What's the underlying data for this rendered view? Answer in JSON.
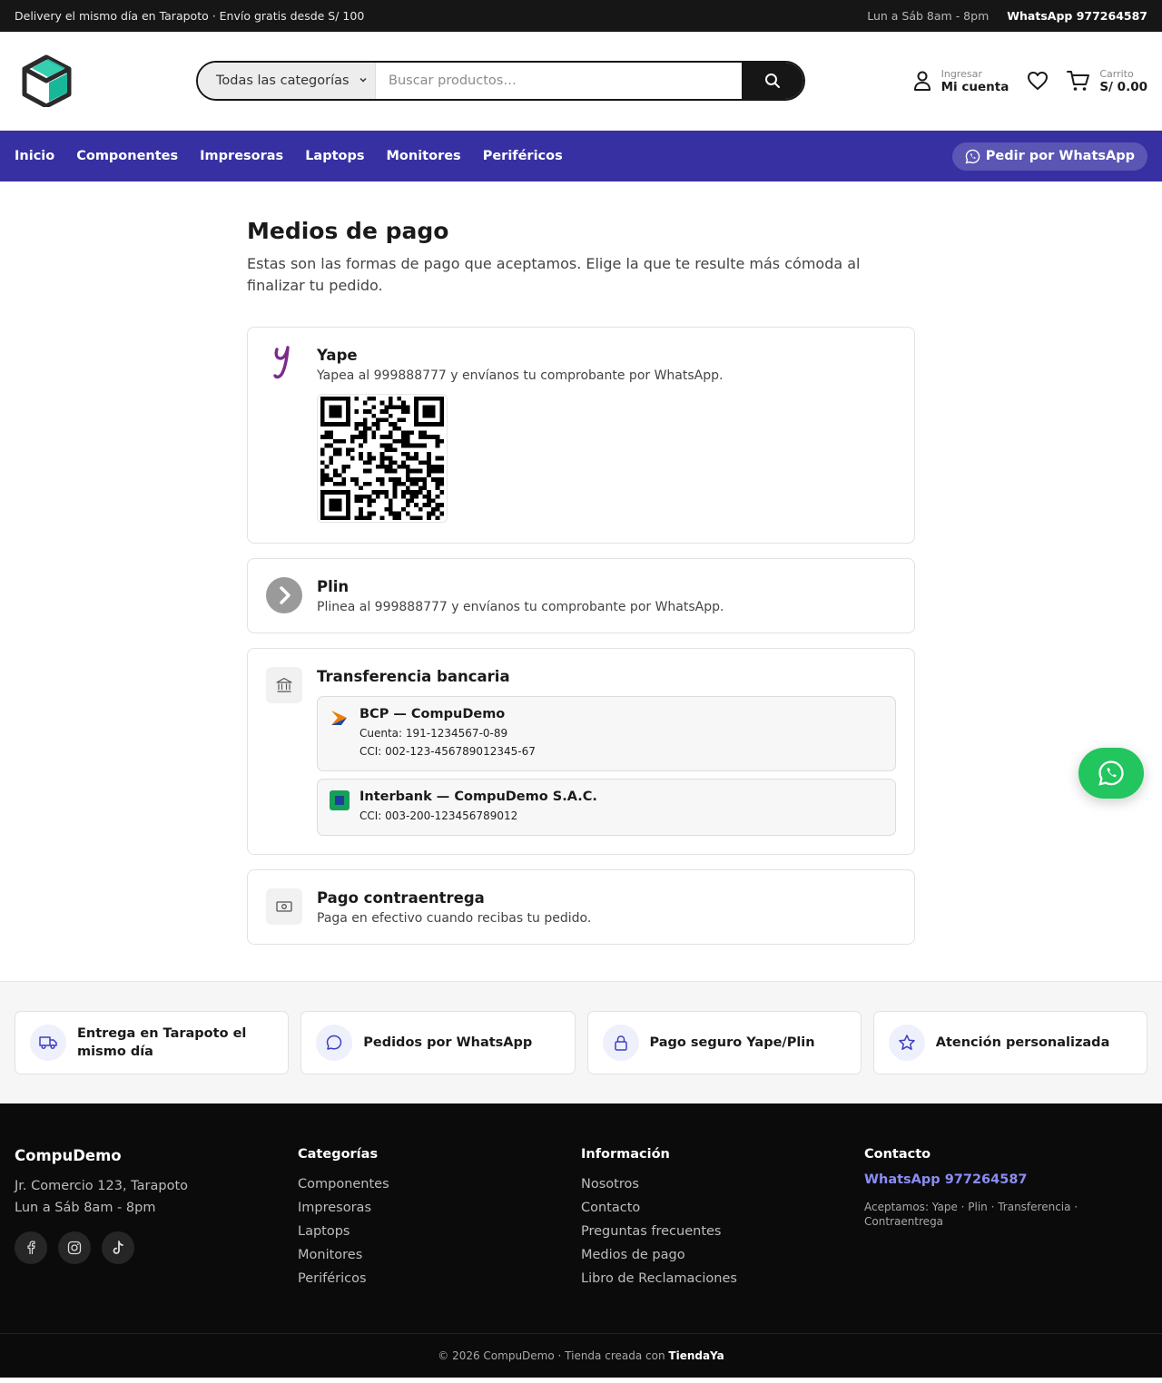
{
  "topbar": {
    "promo": "Delivery el mismo día en Tarapoto · Envío gratis desde S/ 100",
    "hours": "Lun a Sáb 8am - 8pm",
    "whatsapp": "WhatsApp 977264587"
  },
  "header": {
    "search": {
      "category": "Todas las categorías",
      "placeholder": "Buscar productos…",
      "value": ""
    },
    "account": {
      "small": "Ingresar",
      "big": "Mi cuenta"
    },
    "cart": {
      "small": "Carrito",
      "big": "S/ 0.00"
    }
  },
  "nav": {
    "links": [
      "Inicio",
      "Componentes",
      "Impresoras",
      "Laptops",
      "Monitores",
      "Periféricos"
    ],
    "whatsapp_button": "Pedir por WhatsApp"
  },
  "main": {
    "title": "Medios de pago",
    "intro": "Estas son las formas de pago que aceptamos. Elige la que te resulte más cómoda al finalizar tu pedido.",
    "methods": {
      "yape": {
        "title": "Yape",
        "desc": "Yapea al 999888777 y envíanos tu comprobante por WhatsApp.",
        "icon": "yape-logo"
      },
      "plin": {
        "title": "Plin",
        "desc": "Plinea al 999888777 y envíanos tu comprobante por WhatsApp.",
        "icon": "plin-logo"
      },
      "transfer": {
        "title": "Transferencia bancaria",
        "icon": "bank-icon",
        "banks": [
          {
            "name": "BCP — CompuDemo",
            "lines": [
              "Cuenta: 191-1234567-0-89",
              "CCI: 002-123-456789012345-67"
            ]
          },
          {
            "name": "Interbank — CompuDemo S.A.C.",
            "lines": [
              "CCI: 003-200-123456789012"
            ]
          }
        ]
      },
      "cod": {
        "title": "Pago contraentrega",
        "desc": "Paga en efectivo cuando recibas tu pedido.",
        "icon": "cash-icon"
      }
    }
  },
  "features": [
    {
      "label": "Entrega en Tarapoto el mismo día",
      "icon": "truck-icon"
    },
    {
      "label": "Pedidos por WhatsApp",
      "icon": "chat-icon"
    },
    {
      "label": "Pago seguro Yape/Plin",
      "icon": "lock-icon"
    },
    {
      "label": "Atención personalizada",
      "icon": "star-icon"
    }
  ],
  "footer": {
    "brand": "CompuDemo",
    "address": "Jr. Comercio 123, Tarapoto",
    "hours": "Lun a Sáb 8am - 8pm",
    "categories_title": "Categorías",
    "categories": [
      "Componentes",
      "Impresoras",
      "Laptops",
      "Monitores",
      "Periféricos"
    ],
    "info_title": "Información",
    "info": [
      "Nosotros",
      "Contacto",
      "Preguntas frecuentes",
      "Medios de pago",
      "Libro de Reclamaciones"
    ],
    "contact_title": "Contacto",
    "whatsapp": "WhatsApp 977264587",
    "accepts": "Aceptamos: Yape · Plin · Transferencia · Contraentrega",
    "copyright": "© 2026 CompuDemo · Tienda creada con ",
    "builder": "TiendaYa"
  },
  "colors": {
    "nav": "#3730a3",
    "whatsapp_green": "#22c55e",
    "footer_link_accent": "#8b8cf6"
  }
}
